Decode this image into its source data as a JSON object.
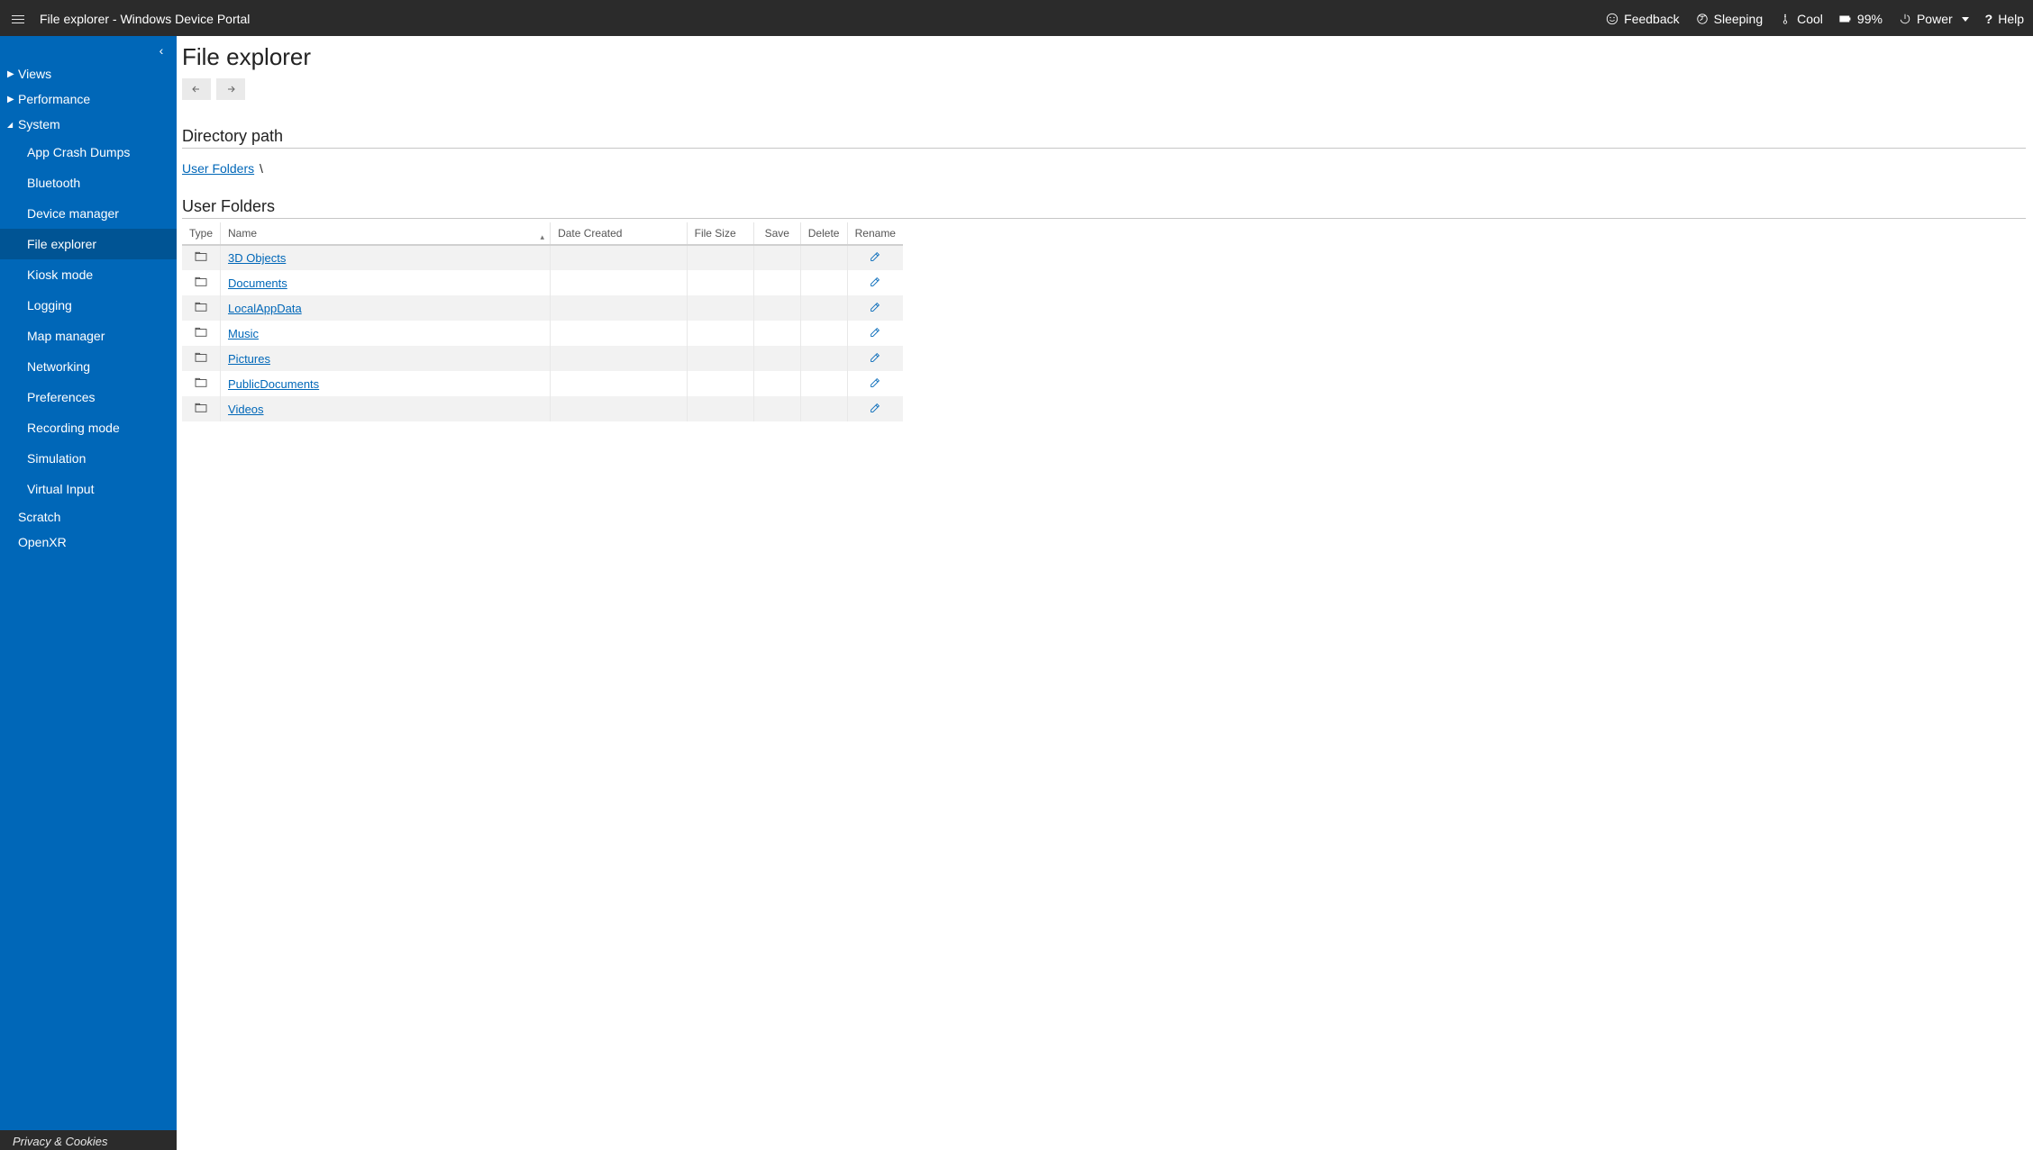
{
  "header": {
    "title": "File explorer - Windows Device Portal",
    "status": {
      "feedback": "Feedback",
      "sleeping": "Sleeping",
      "cool": "Cool",
      "battery": "99%",
      "power": "Power",
      "help": "Help"
    }
  },
  "sidebar": {
    "collapse_icon": "‹",
    "sections": [
      {
        "label": "Views",
        "expanded": false
      },
      {
        "label": "Performance",
        "expanded": false
      },
      {
        "label": "System",
        "expanded": true,
        "children": [
          {
            "label": "App Crash Dumps"
          },
          {
            "label": "Bluetooth"
          },
          {
            "label": "Device manager"
          },
          {
            "label": "File explorer",
            "active": true
          },
          {
            "label": "Kiosk mode"
          },
          {
            "label": "Logging"
          },
          {
            "label": "Map manager"
          },
          {
            "label": "Networking"
          },
          {
            "label": "Preferences"
          },
          {
            "label": "Recording mode"
          },
          {
            "label": "Simulation"
          },
          {
            "label": "Virtual Input"
          }
        ]
      },
      {
        "label": "Scratch",
        "expanded": null
      },
      {
        "label": "OpenXR",
        "expanded": null
      }
    ],
    "footer": "Privacy & Cookies"
  },
  "main": {
    "page_title": "File explorer",
    "directory_path_heading": "Directory path",
    "breadcrumb_root": "User Folders",
    "breadcrumb_sep": "\\",
    "listing_heading": "User Folders",
    "columns": {
      "type": "Type",
      "name": "Name",
      "date_created": "Date Created",
      "file_size": "File Size",
      "save": "Save",
      "delete": "Delete",
      "rename": "Rename"
    },
    "rows": [
      {
        "name": "3D Objects"
      },
      {
        "name": "Documents"
      },
      {
        "name": "LocalAppData"
      },
      {
        "name": "Music"
      },
      {
        "name": "Pictures"
      },
      {
        "name": "PublicDocuments"
      },
      {
        "name": "Videos"
      }
    ]
  }
}
